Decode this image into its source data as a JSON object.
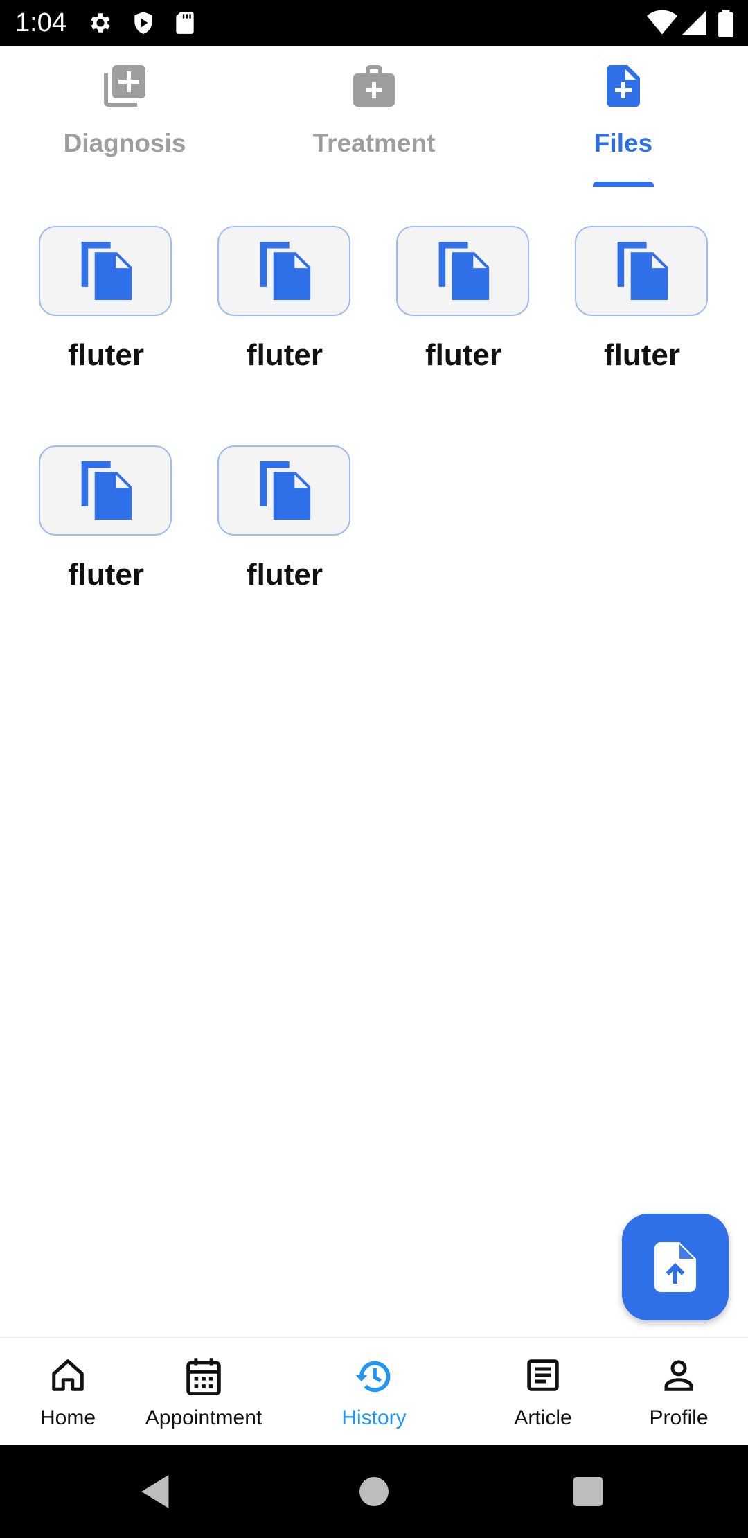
{
  "status_bar": {
    "time": "1:04",
    "icons": [
      "settings-icon",
      "shield-icon",
      "sd-card-icon",
      "wifi-icon",
      "signal-icon",
      "battery-icon"
    ]
  },
  "tabs": [
    {
      "label": "Diagnosis",
      "icon": "add-to-photos-icon",
      "active": false
    },
    {
      "label": "Treatment",
      "icon": "medical-kit-icon",
      "active": false
    },
    {
      "label": "Files",
      "icon": "file-plus-icon",
      "active": true
    }
  ],
  "files": [
    {
      "name": "fluter"
    },
    {
      "name": "fluter"
    },
    {
      "name": "fluter"
    },
    {
      "name": "fluter"
    },
    {
      "name": "fluter"
    },
    {
      "name": "fluter"
    }
  ],
  "fab": {
    "icon": "upload-file-icon"
  },
  "bottom_nav": [
    {
      "label": "Home",
      "icon": "home-icon",
      "active": false
    },
    {
      "label": "Appointment",
      "icon": "calendar-icon",
      "active": false
    },
    {
      "label": "History",
      "icon": "history-icon",
      "active": true
    },
    {
      "label": "Article",
      "icon": "article-icon",
      "active": false
    },
    {
      "label": "Profile",
      "icon": "person-icon",
      "active": false
    }
  ],
  "colors": {
    "accent": "#2f6fe8",
    "nav_active": "#2196f3",
    "inactive": "#9e9e9e"
  }
}
